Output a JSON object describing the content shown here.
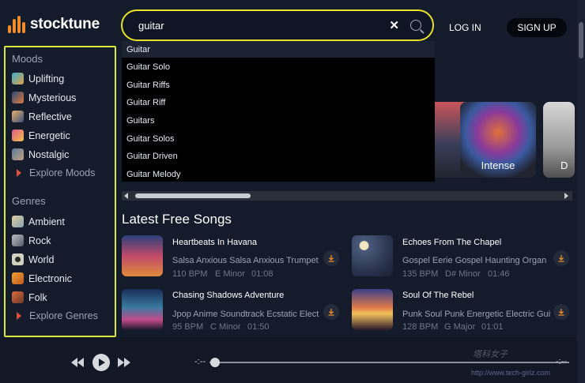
{
  "header": {
    "brand": "stocktune",
    "search_value": "guitar",
    "clear_glyph": "✕",
    "login_label": "LOG IN",
    "signup_label": "SIGN UP"
  },
  "sidebar": {
    "moods_heading": "Moods",
    "moods": [
      {
        "label": "Uplifting",
        "icon": "uplifting-icon"
      },
      {
        "label": "Mysterious",
        "icon": "mysterious-icon"
      },
      {
        "label": "Reflective",
        "icon": "reflective-icon"
      },
      {
        "label": "Energetic",
        "icon": "energetic-icon"
      },
      {
        "label": "Nostalgic",
        "icon": "nostalgic-icon"
      }
    ],
    "explore_moods": "Explore Moods",
    "genres_heading": "Genres",
    "genres": [
      {
        "label": "Ambient",
        "icon": "ambient-icon"
      },
      {
        "label": "Rock",
        "icon": "rock-icon"
      },
      {
        "label": "World",
        "icon": "world-icon"
      },
      {
        "label": "Electronic",
        "icon": "electronic-icon"
      },
      {
        "label": "Folk",
        "icon": "folk-icon"
      }
    ],
    "explore_genres": "Explore Genres"
  },
  "suggestions": [
    "Guitar",
    "Guitar Solo",
    "Guitar Riffs",
    "Guitar Riff",
    "Guitars",
    "Guitar Solos",
    "Guitar Driven",
    "Guitar Melody"
  ],
  "carousel": {
    "cards": [
      {
        "label": ""
      },
      {
        "label": "Intense"
      },
      {
        "label": "D"
      }
    ]
  },
  "latest": {
    "title": "Latest Free Songs",
    "songs": [
      {
        "title": "Heartbeats In Havana",
        "tags": "Salsa  Anxious Salsa  Anxious  Trumpet",
        "bpm": "110 BPM",
        "key": "E Minor",
        "duration": "01:08"
      },
      {
        "title": "Echoes From The Chapel",
        "tags": "Gospel  Eerie Gospel  Haunting  Organ",
        "bpm": "135 BPM",
        "key": "D# Minor",
        "duration": "01:46"
      },
      {
        "title": "Chasing Shadows Adventure",
        "tags": "Jpop  Anime Soundtrack  Ecstatic  Elect",
        "bpm": "95 BPM",
        "key": "C Minor",
        "duration": "01:50"
      },
      {
        "title": "Soul Of The Rebel",
        "tags": "Punk  Soul Punk  Energetic  Electric Guit",
        "bpm": "128 BPM",
        "key": "G Major",
        "duration": "01:01"
      }
    ]
  },
  "player": {
    "time_elapsed": "-:--",
    "time_total": "-:--"
  },
  "watermark": {
    "text": "塔科女子",
    "url": "http://www.tech-girlz.com"
  },
  "colors": {
    "accent": "#f08c2a",
    "highlight": "#d9e83a",
    "background": "#141b2b"
  }
}
